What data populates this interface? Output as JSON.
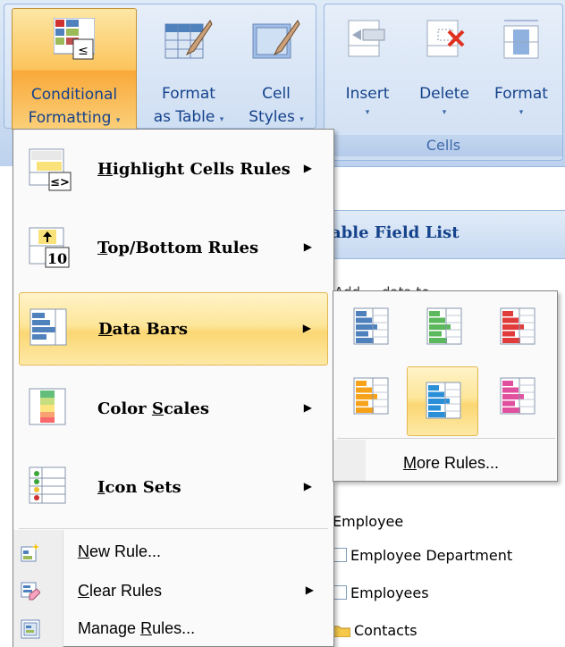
{
  "ribbon": {
    "styles_group": {
      "conditional_formatting": {
        "line1": "Conditional",
        "line2": "Formatting"
      },
      "format_as_table": {
        "line1": "Format",
        "line2": "as Table"
      },
      "cell_styles": {
        "line1": "Cell",
        "line2": "Styles"
      }
    },
    "cells_group": {
      "label": "Cells",
      "insert": "Insert",
      "delete": "Delete",
      "format": "Format"
    }
  },
  "field_list": {
    "title": "able Field List",
    "hint": "Add ... data to ..."
  },
  "menu": {
    "items": [
      {
        "pre": "",
        "key": "H",
        "post": "ighlight Cells Rules",
        "icon": "highlight-cells-icon",
        "has_submenu": true
      },
      {
        "pre": "",
        "key": "T",
        "post": "op/Bottom Rules",
        "icon": "top-bottom-icon",
        "has_submenu": true
      },
      {
        "pre": "",
        "key": "D",
        "post": "ata Bars",
        "icon": "data-bars-icon",
        "has_submenu": true,
        "highlighted": true
      },
      {
        "pre": "Color ",
        "key": "S",
        "post": "cales",
        "icon": "color-scales-icon",
        "has_submenu": true
      },
      {
        "pre": "",
        "key": "I",
        "post": "con Sets",
        "icon": "icon-sets-icon",
        "has_submenu": true
      }
    ],
    "small_items": [
      {
        "pre": "",
        "key": "N",
        "post": "ew Rule...",
        "icon": "new-rule-icon"
      },
      {
        "pre": "",
        "key": "C",
        "post": "lear Rules",
        "icon": "clear-rules-icon",
        "has_submenu": true
      },
      {
        "pre": "Manage ",
        "key": "R",
        "post": "ules...",
        "icon": "manage-rules-icon"
      }
    ]
  },
  "data_bars_submenu": {
    "swatches": [
      {
        "name": "blue-data-bar",
        "color": "#4f81bd"
      },
      {
        "name": "green-data-bar",
        "color": "#5cb85c"
      },
      {
        "name": "red-data-bar",
        "color": "#e03c3c"
      },
      {
        "name": "orange-data-bar",
        "color": "#f7a21b"
      },
      {
        "name": "light-blue-data-bar",
        "color": "#2b8fd8",
        "selected": true
      },
      {
        "name": "purple-data-bar",
        "color": "#e0509f"
      }
    ],
    "more_rules": {
      "pre": "",
      "key": "M",
      "post": "ore Rules..."
    }
  },
  "tree": [
    {
      "label": "Employee",
      "kind": "table"
    },
    {
      "label": "Employee Department",
      "kind": "checkbox"
    },
    {
      "label": "Employees",
      "kind": "checkbox"
    },
    {
      "label": "Contacts",
      "kind": "folder"
    }
  ],
  "colors": {
    "ribbon_text": "#15428b",
    "hover_gold": "#fbd774",
    "menu_border": "#868686"
  }
}
